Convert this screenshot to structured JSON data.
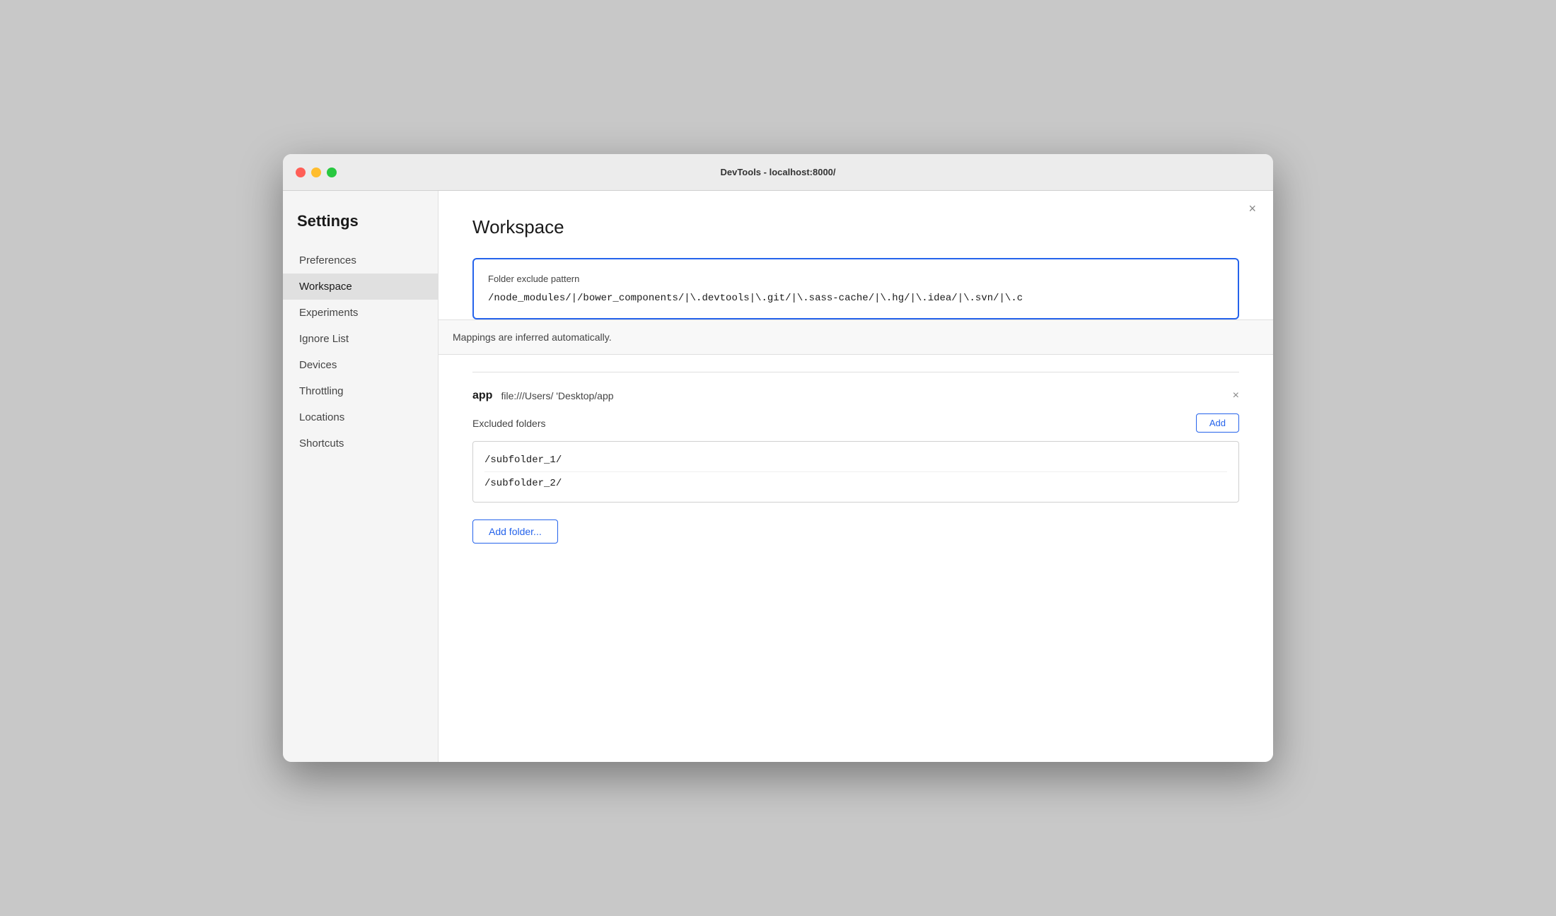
{
  "window": {
    "title": "DevTools - localhost:8000/",
    "close_label": "×"
  },
  "sidebar": {
    "heading": "Settings",
    "items": [
      {
        "id": "preferences",
        "label": "Preferences",
        "active": false
      },
      {
        "id": "workspace",
        "label": "Workspace",
        "active": true
      },
      {
        "id": "experiments",
        "label": "Experiments",
        "active": false
      },
      {
        "id": "ignore-list",
        "label": "Ignore List",
        "active": false
      },
      {
        "id": "devices",
        "label": "Devices",
        "active": false
      },
      {
        "id": "throttling",
        "label": "Throttling",
        "active": false
      },
      {
        "id": "locations",
        "label": "Locations",
        "active": false
      },
      {
        "id": "shortcuts",
        "label": "Shortcuts",
        "active": false
      }
    ]
  },
  "content": {
    "title": "Workspace",
    "folder_exclude": {
      "label": "Folder exclude pattern",
      "value": "/node_modules/|/bower_components/|\\.devtools|\\.git/|\\.sass-cache/|\\.hg/|\\.idea/|\\.svn/|\\.c"
    },
    "mappings_info": "Mappings are inferred automatically.",
    "workspace_entry": {
      "name": "app",
      "path": "file:///Users/      'Desktop/app",
      "remove_label": "×"
    },
    "excluded_folders": {
      "label": "Excluded folders",
      "add_label": "Add",
      "folders": [
        {
          "path": "/subfolder_1/"
        },
        {
          "path": "/subfolder_2/"
        }
      ]
    },
    "add_folder_label": "Add folder..."
  },
  "colors": {
    "accent": "#2563eb"
  }
}
